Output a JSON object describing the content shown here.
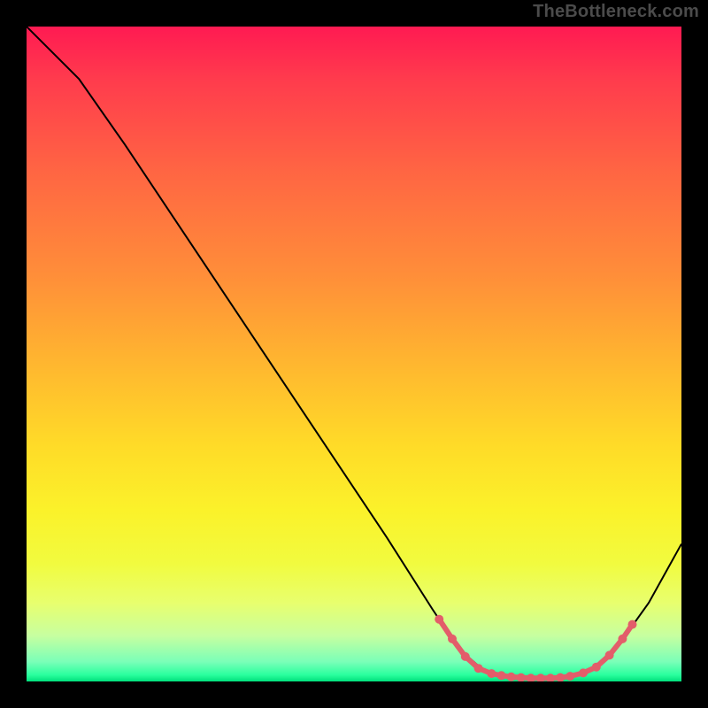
{
  "watermark": "TheBottleneck.com",
  "chart_data": {
    "type": "line",
    "title": "",
    "xlabel": "",
    "ylabel": "",
    "xlim": [
      0,
      100
    ],
    "ylim": [
      0,
      100
    ],
    "grid": false,
    "series": [
      {
        "name": "curve",
        "stroke": "#000000",
        "stroke_width": 2,
        "points": [
          {
            "x": 0,
            "y": 100
          },
          {
            "x": 8,
            "y": 92
          },
          {
            "x": 15,
            "y": 82
          },
          {
            "x": 25,
            "y": 67
          },
          {
            "x": 35,
            "y": 52
          },
          {
            "x": 45,
            "y": 37
          },
          {
            "x": 55,
            "y": 22
          },
          {
            "x": 62,
            "y": 11
          },
          {
            "x": 66,
            "y": 5
          },
          {
            "x": 70,
            "y": 1.5
          },
          {
            "x": 74,
            "y": 0.5
          },
          {
            "x": 78,
            "y": 0.5
          },
          {
            "x": 82,
            "y": 0.5
          },
          {
            "x": 86,
            "y": 1.5
          },
          {
            "x": 90,
            "y": 5
          },
          {
            "x": 95,
            "y": 12
          },
          {
            "x": 100,
            "y": 21
          }
        ]
      }
    ],
    "markers": {
      "name": "bottom-markers",
      "fill": "#e35d6a",
      "radius": 5,
      "points": [
        {
          "x": 63,
          "y": 9.5
        },
        {
          "x": 65,
          "y": 6.5
        },
        {
          "x": 67,
          "y": 3.8
        },
        {
          "x": 69,
          "y": 2.0
        },
        {
          "x": 71,
          "y": 1.2
        },
        {
          "x": 72.5,
          "y": 0.9
        },
        {
          "x": 74,
          "y": 0.7
        },
        {
          "x": 75.5,
          "y": 0.6
        },
        {
          "x": 77,
          "y": 0.5
        },
        {
          "x": 78.5,
          "y": 0.5
        },
        {
          "x": 80,
          "y": 0.5
        },
        {
          "x": 81.5,
          "y": 0.6
        },
        {
          "x": 83,
          "y": 0.8
        },
        {
          "x": 85,
          "y": 1.3
        },
        {
          "x": 87,
          "y": 2.2
        },
        {
          "x": 89,
          "y": 4.0
        },
        {
          "x": 91,
          "y": 6.5
        },
        {
          "x": 92.5,
          "y": 8.7
        }
      ]
    }
  }
}
